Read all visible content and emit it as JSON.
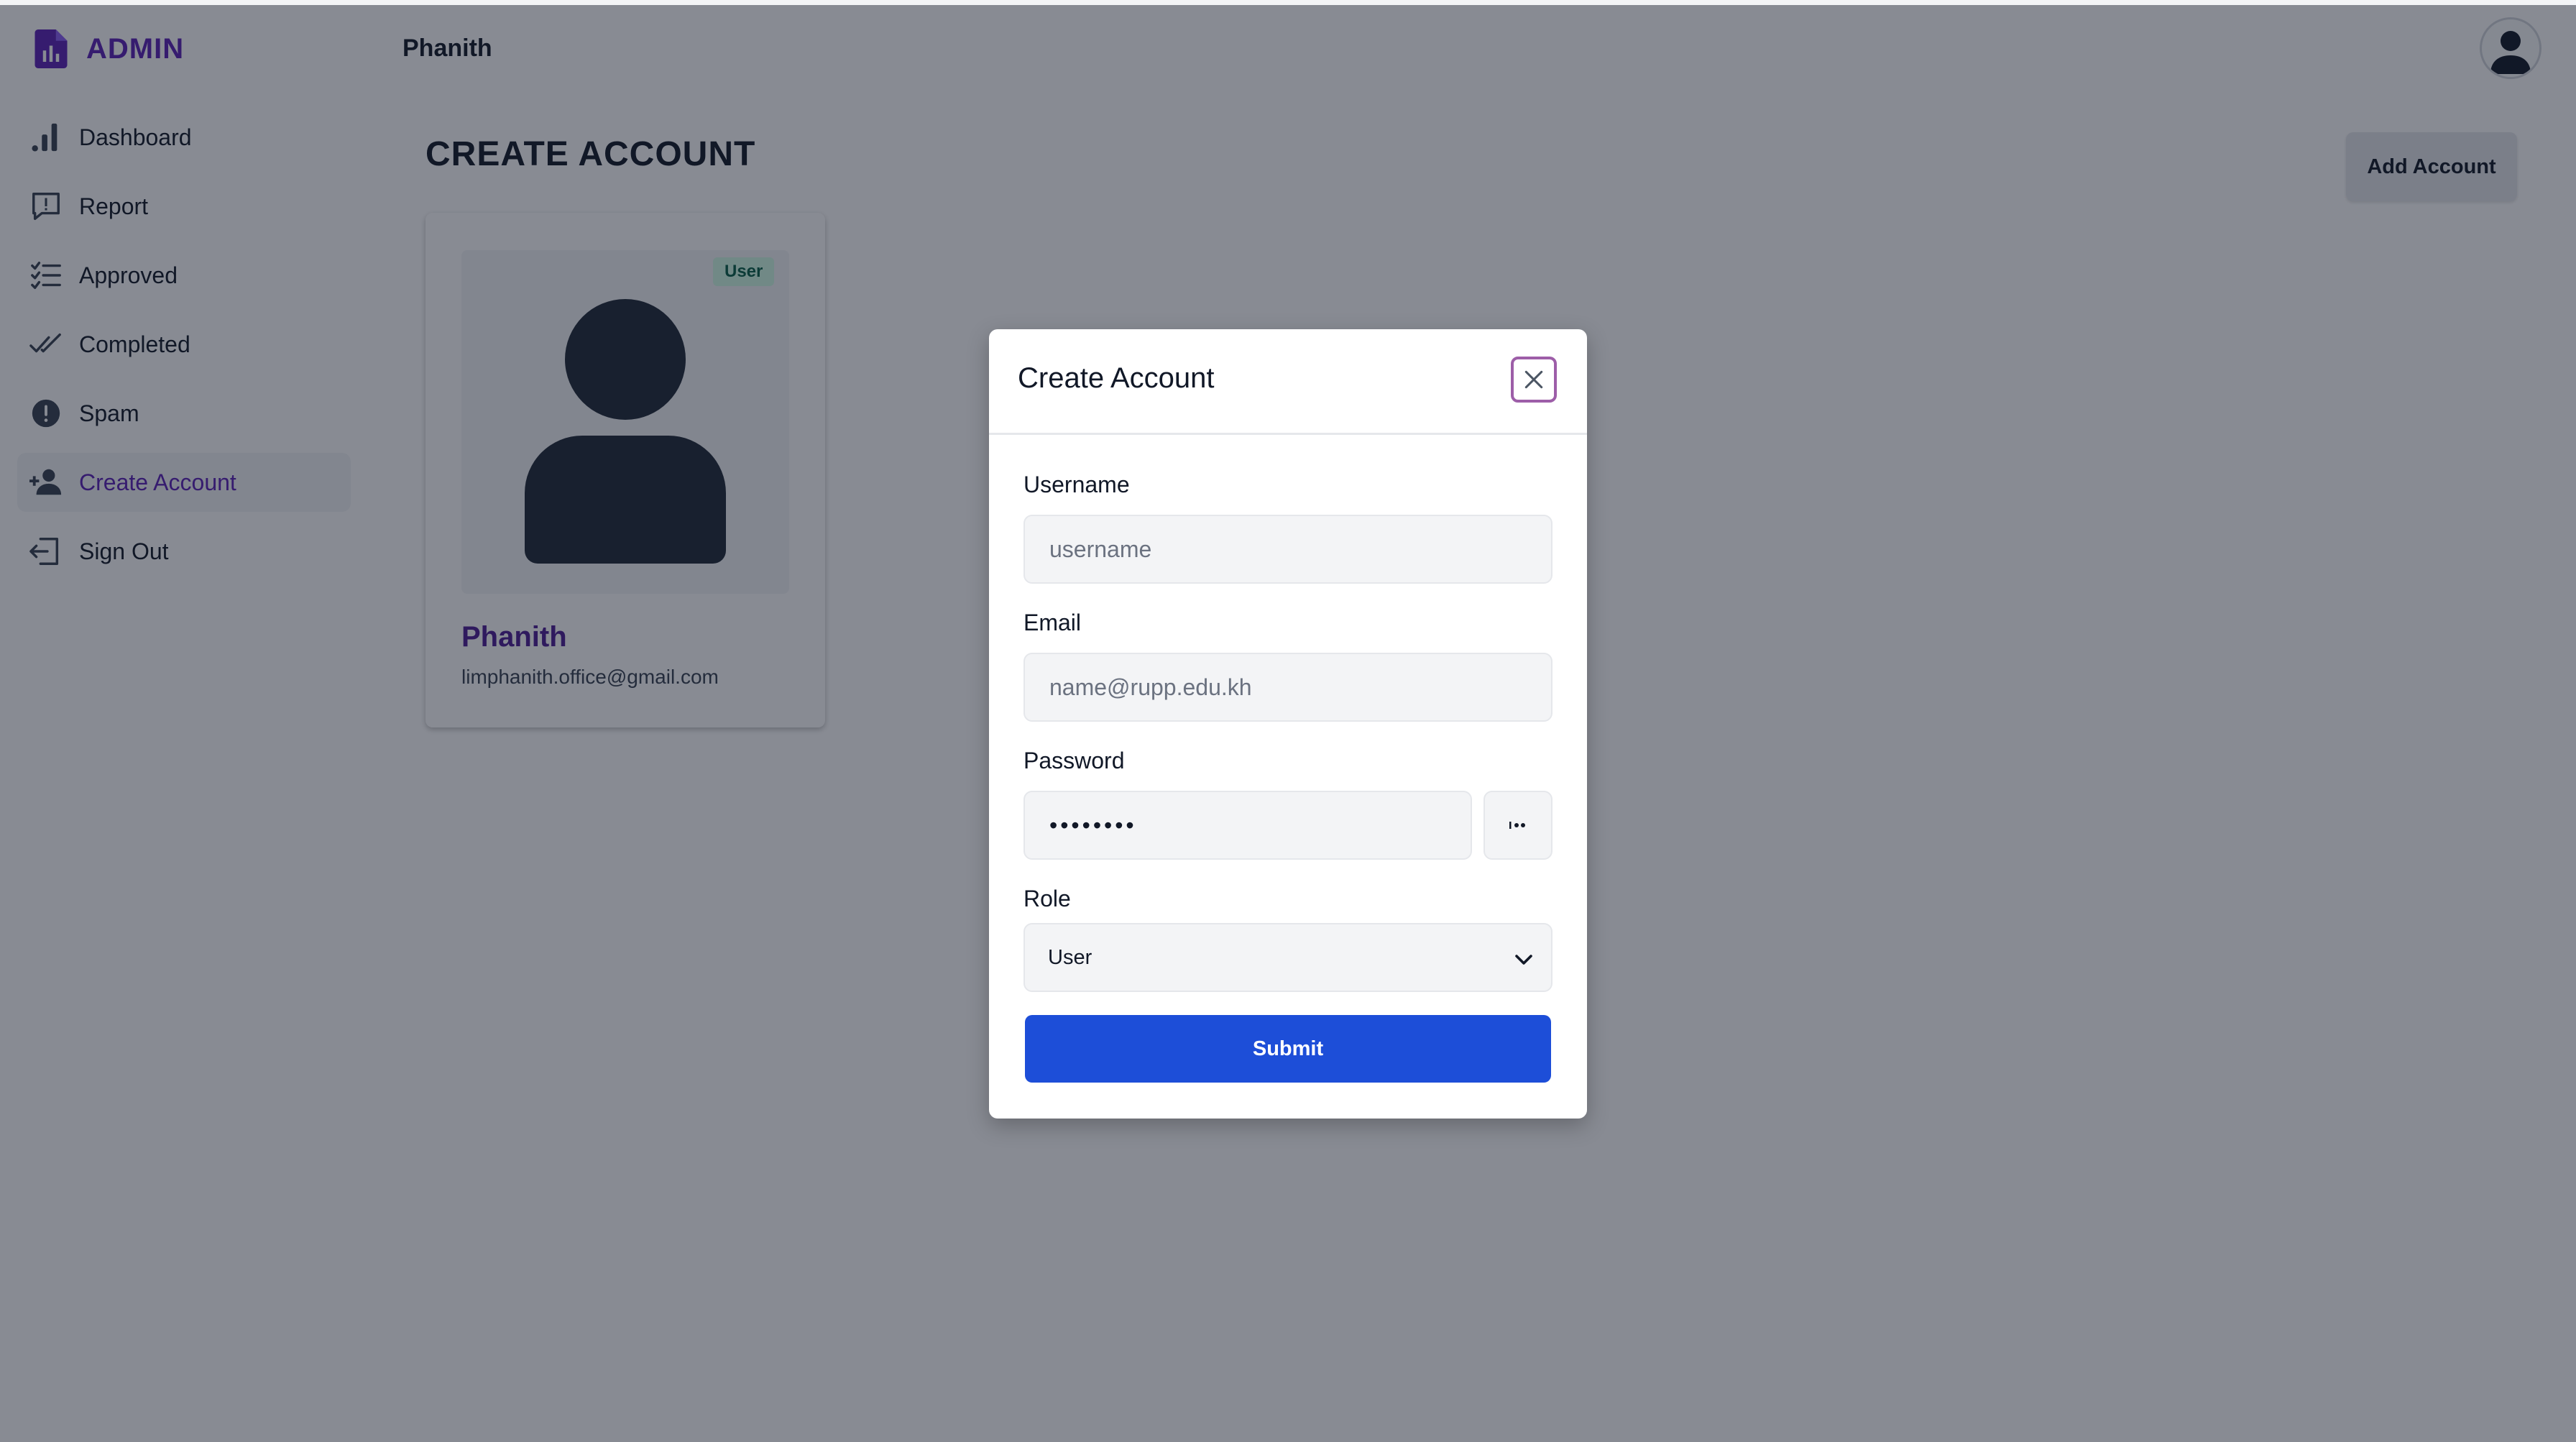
{
  "app": {
    "brand": "ADMIN",
    "user_name": "Phanith"
  },
  "sidebar": {
    "items": [
      {
        "label": "Dashboard",
        "icon": "bar-chart-icon"
      },
      {
        "label": "Report",
        "icon": "report-icon"
      },
      {
        "label": "Approved",
        "icon": "checklist-icon"
      },
      {
        "label": "Completed",
        "icon": "double-check-icon"
      },
      {
        "label": "Spam",
        "icon": "alert-circle-icon"
      },
      {
        "label": "Create Account",
        "icon": "user-plus-icon",
        "active": true
      },
      {
        "label": "Sign Out",
        "icon": "sign-out-icon"
      }
    ]
  },
  "main": {
    "title": "CREATE ACCOUNT",
    "add_button": "Add Account",
    "card": {
      "role": "User",
      "name": "Phanith",
      "email": "limphanith.office@gmail.com"
    }
  },
  "modal": {
    "title": "Create Account",
    "username": {
      "label": "Username",
      "placeholder": "username",
      "value": ""
    },
    "email": {
      "label": "Email",
      "placeholder": "name@rupp.edu.kh",
      "value": ""
    },
    "password": {
      "label": "Password",
      "value": "••••••••"
    },
    "role": {
      "label": "Role",
      "value": "User"
    },
    "submit": "Submit"
  },
  "colors": {
    "accent": "#5b21b6",
    "primary_button": "#1d4ed8",
    "overlay": "rgba(17,24,39,0.5)"
  }
}
